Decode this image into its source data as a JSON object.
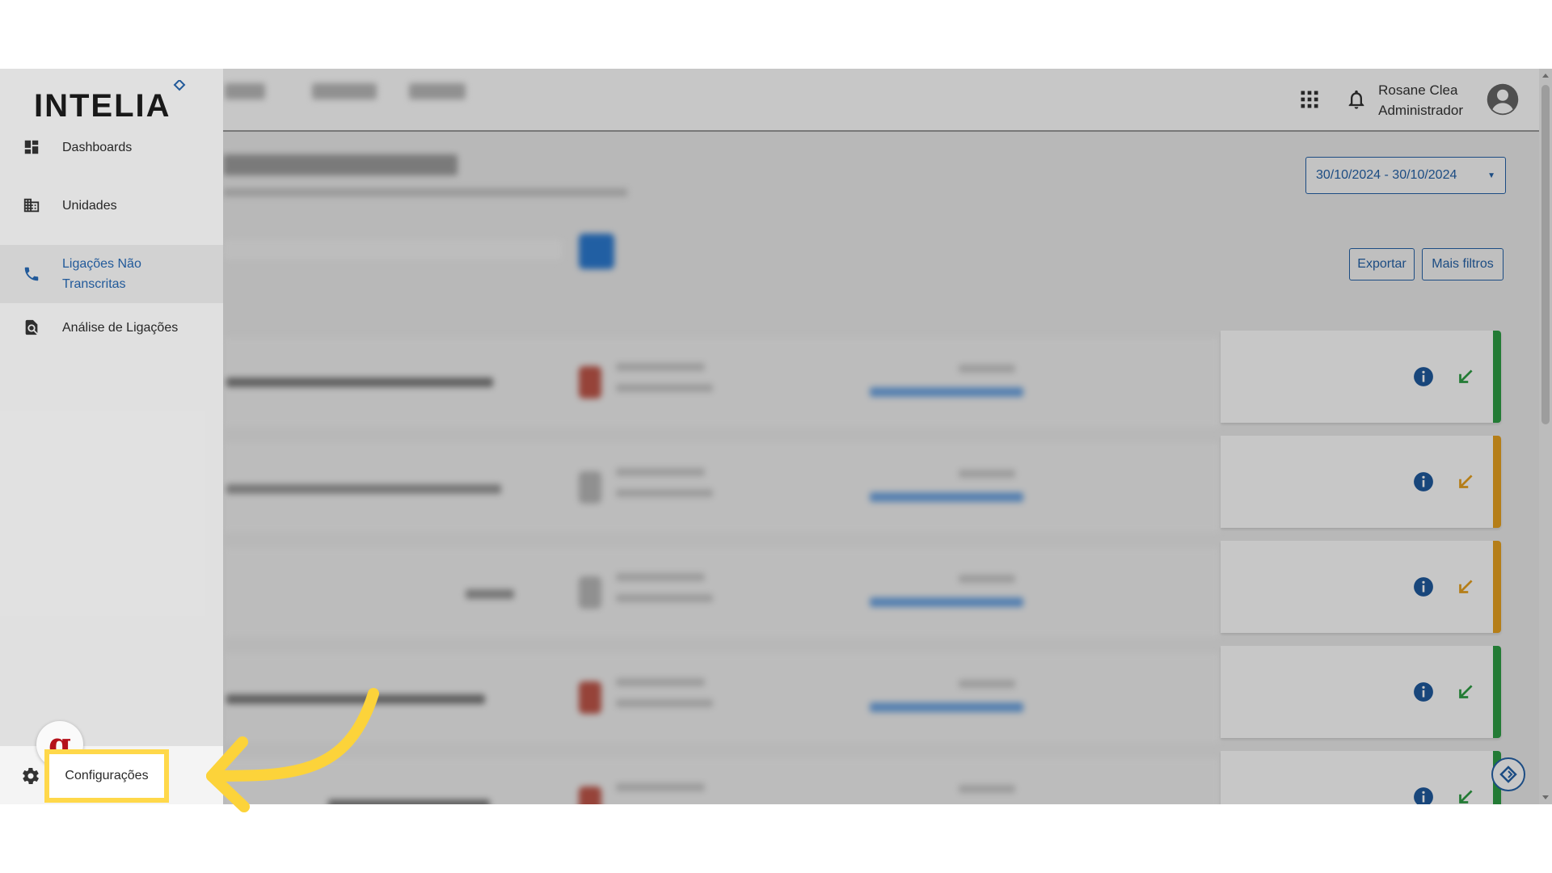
{
  "header": {
    "user_name": "Rosane Clea",
    "user_role": "Administrador"
  },
  "sidebar": {
    "brand": "INTELIA",
    "items": [
      {
        "label": "Dashboards",
        "icon": "dashboard-icon"
      },
      {
        "label": "Unidades",
        "icon": "building-icon"
      },
      {
        "label": "Ligações Não Transcritas",
        "icon": "phone-icon",
        "active": true
      },
      {
        "label": "Análise de Ligações",
        "icon": "search-document-icon"
      }
    ],
    "settings_label": "Configurações",
    "badge_letter": "g"
  },
  "filters": {
    "date_range": "30/10/2024 - 30/10/2024",
    "export_label": "Exportar",
    "more_filters_label": "Mais filtros"
  },
  "cards": [
    {
      "status_color": "#2e9e44",
      "arrow_color": "#2e9e44"
    },
    {
      "status_color": "#e8a21f",
      "arrow_color": "#e8a21f"
    },
    {
      "status_color": "#e8a21f",
      "arrow_color": "#e8a21f"
    },
    {
      "status_color": "#2e9e44",
      "arrow_color": "#2e9e44"
    },
    {
      "status_color": "#2e9e44",
      "arrow_color": "#2e9e44"
    }
  ],
  "colors": {
    "accent": "#2562a8",
    "highlight": "#ffd84a",
    "annotation_arrow": "#fcd33a"
  }
}
